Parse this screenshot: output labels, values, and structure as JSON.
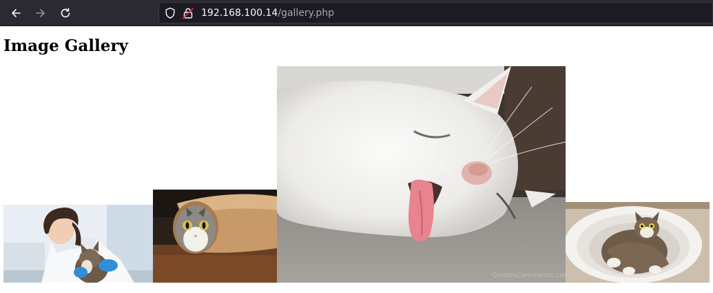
{
  "browser": {
    "url_host": "192.168.100.14",
    "url_path": "/gallery.php",
    "icons": [
      "back-arrow-icon",
      "forward-arrow-icon",
      "reload-icon",
      "shield-icon",
      "insecure-lock-icon"
    ]
  },
  "page": {
    "title": "Image Gallery"
  },
  "gallery": {
    "images": [
      {
        "subject": "veterinarian-with-cat"
      },
      {
        "subject": "cat-in-paper-roll"
      },
      {
        "subject": "sleeping-white-cat-tongue-out"
      },
      {
        "subject": "cat-in-toilet-bowl"
      }
    ],
    "watermark": "QuotesComments.com"
  },
  "colors": {
    "toolbar_bg": "#2b2a33",
    "urlbar_bg": "#1c1b22",
    "url_host": "#fbfbfe",
    "url_path": "#a8a7b1",
    "insecure_lock": "#e22850"
  }
}
